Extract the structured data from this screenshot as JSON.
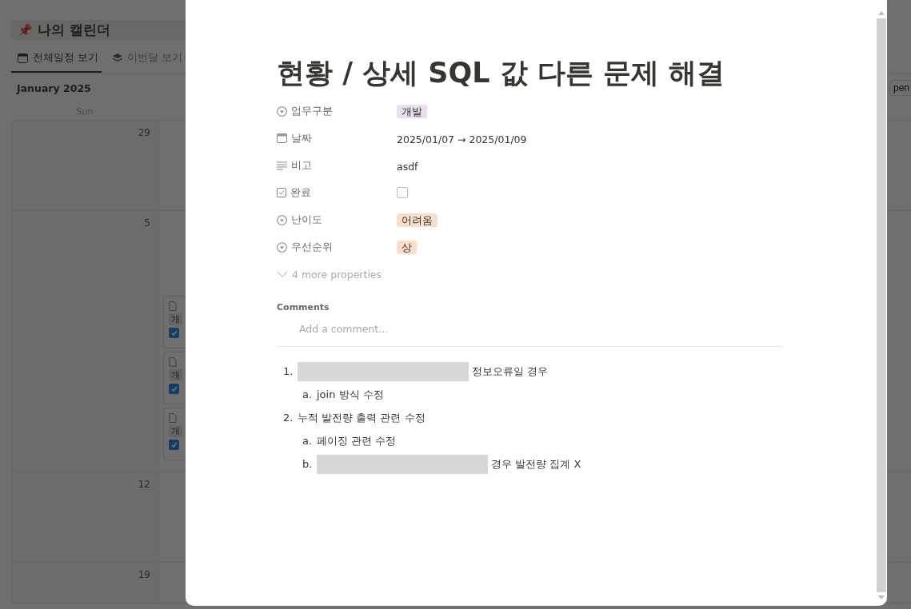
{
  "calendar": {
    "title_icon": "📌",
    "title": "나의 캘린더",
    "tabs": [
      {
        "label": "전체일정 보기",
        "selected": true
      },
      {
        "label": "이번달 보기",
        "selected": false
      }
    ],
    "month": "January 2025",
    "open_button": "pen",
    "weekday": "Sun",
    "weeks": [
      {
        "date": "29"
      },
      {
        "date": "5",
        "cards": [
          {
            "tag": "개",
            "checked": true
          },
          {
            "tag": "개",
            "checked": true
          },
          {
            "tag": "개",
            "checked": true
          }
        ]
      },
      {
        "date": "12"
      },
      {
        "date": "19"
      }
    ]
  },
  "page": {
    "title": "현황 / 상세 SQL 값 다른 문제 해결",
    "properties": [
      {
        "name": "업무구분",
        "kind": "tag",
        "value": "개발",
        "color": "#e8deee"
      },
      {
        "name": "날짜",
        "kind": "date",
        "value": "2025/01/07 → 2025/01/09"
      },
      {
        "name": "비고",
        "kind": "text",
        "value": "asdf"
      },
      {
        "name": "완료",
        "kind": "checkbox",
        "checked": false
      },
      {
        "name": "난이도",
        "kind": "tag",
        "value": "어려움",
        "color": "#fadec9"
      },
      {
        "name": "우선순위",
        "kind": "tag",
        "value": "상",
        "color": "#fadec9"
      }
    ],
    "more_properties": "4 more properties",
    "comments_heading": "Comments",
    "comment_placeholder": "Add a comment...",
    "list": [
      {
        "marker": "1.",
        "redacted": true,
        "text": "정보오류일 경우",
        "children": [
          {
            "marker": "a.",
            "redacted": false,
            "text": "join 방식 수정"
          }
        ]
      },
      {
        "marker": "2.",
        "redacted": false,
        "text": "누적 발전량 출력 관련 수정",
        "children": [
          {
            "marker": "a.",
            "redacted": false,
            "text": "페이징 관련 수정"
          },
          {
            "marker": "b.",
            "redacted": true,
            "text": "경우 발전량 집계 X"
          }
        ]
      }
    ]
  }
}
